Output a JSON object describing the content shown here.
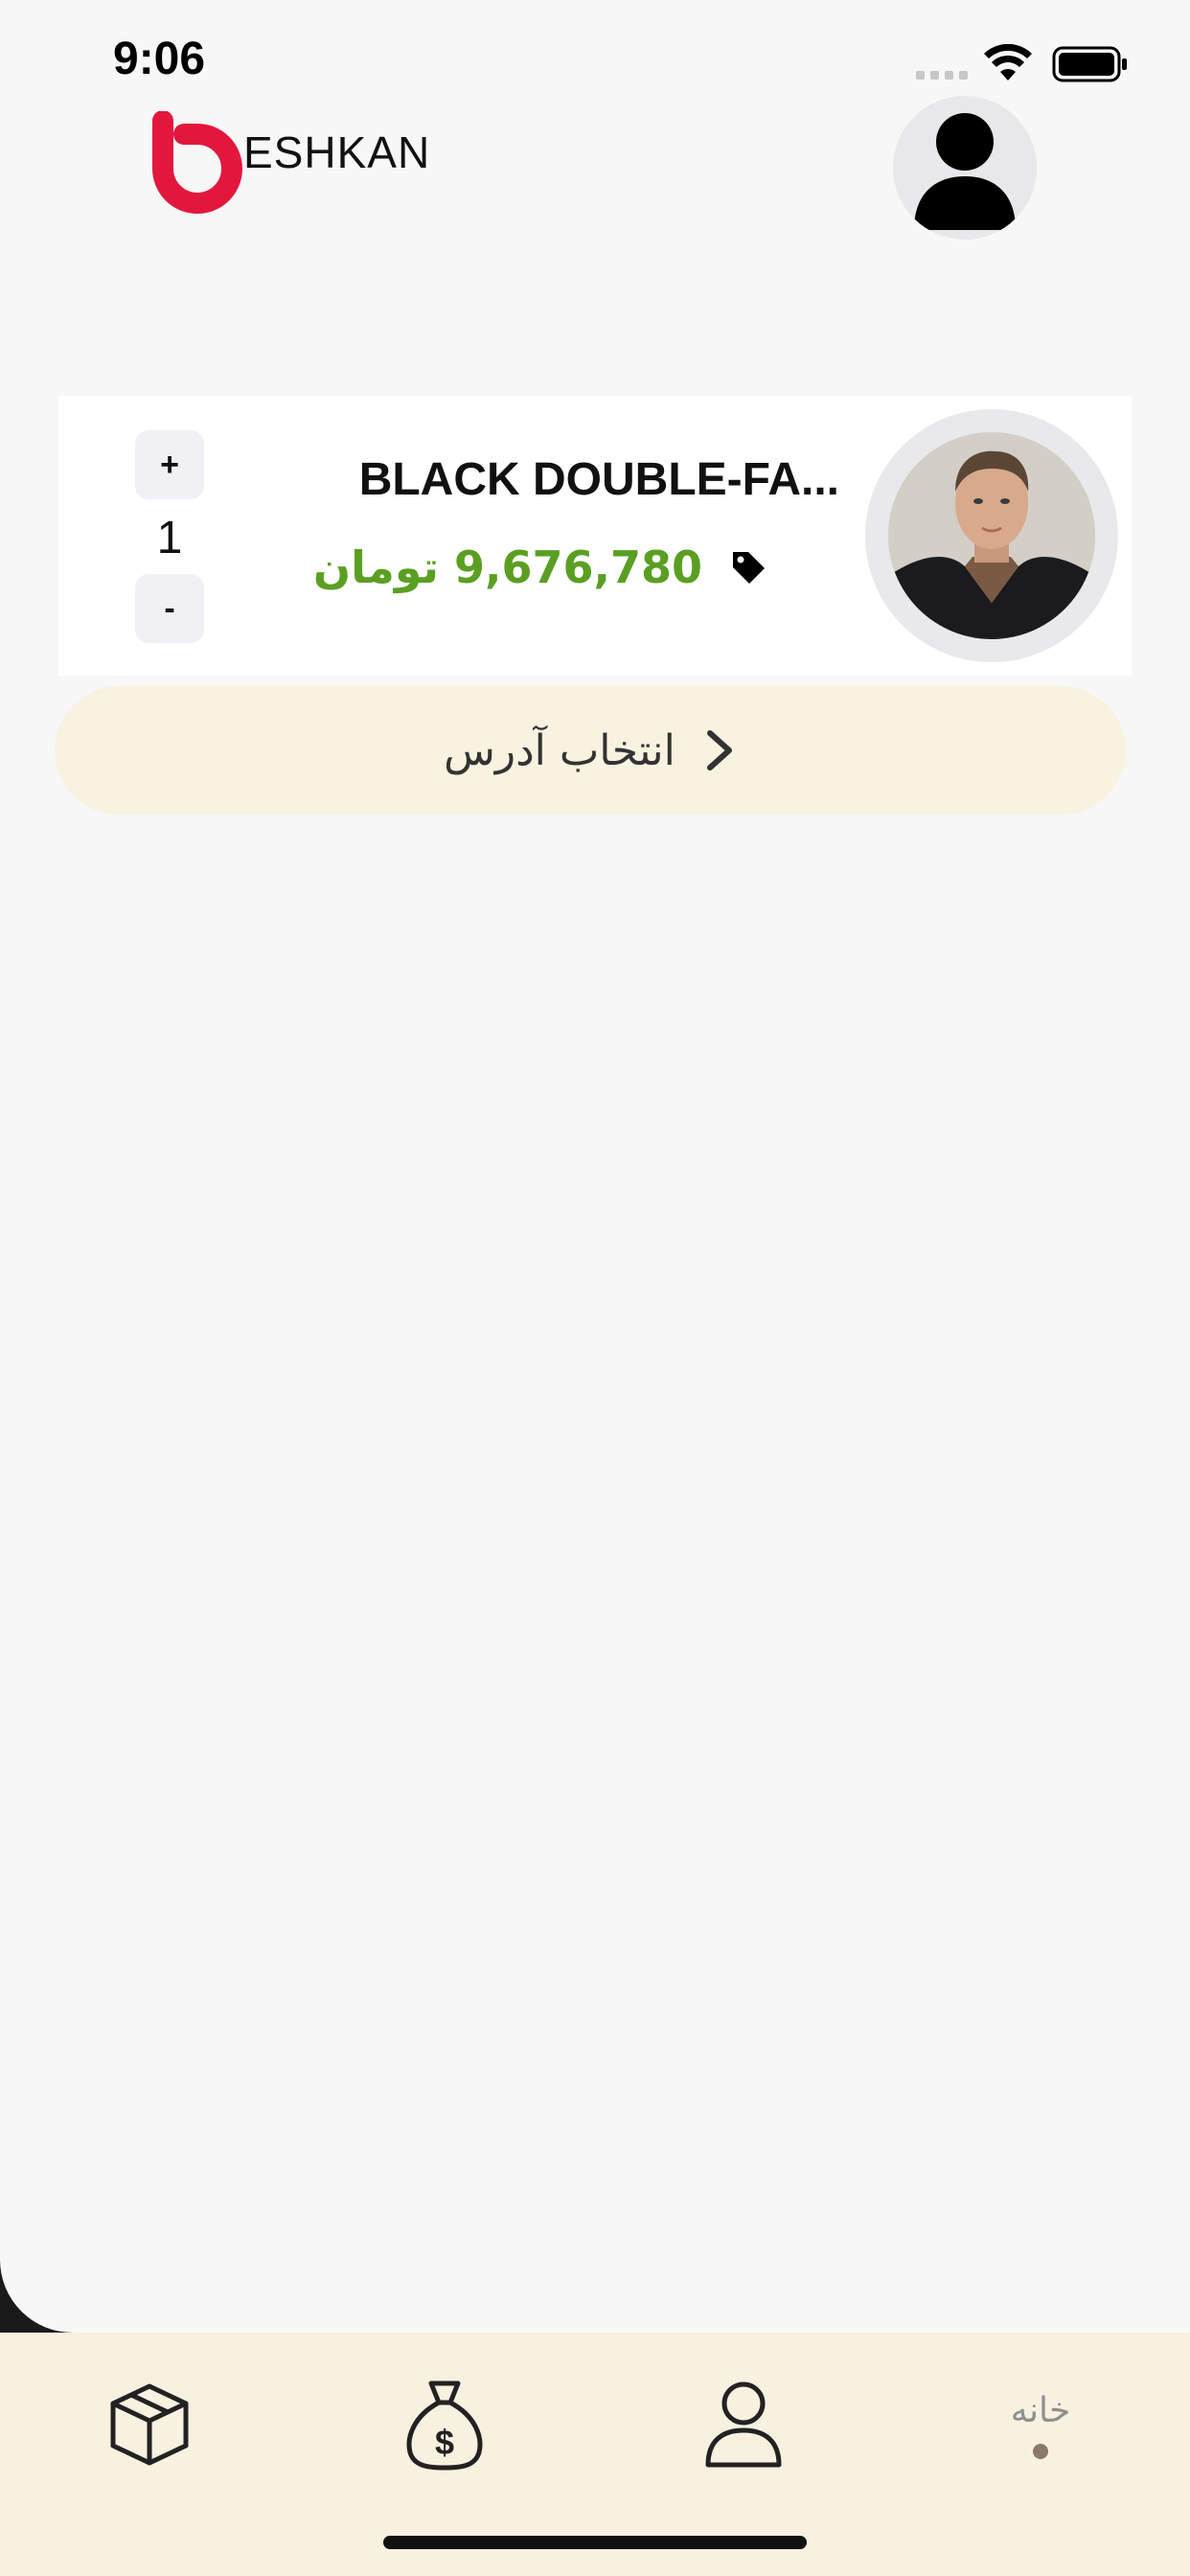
{
  "status_bar": {
    "time": "9:06"
  },
  "header": {
    "logo_text": "ESHKAN",
    "logo_color": "#e3173e",
    "avatar_icon": "user-avatar-icon"
  },
  "cart": {
    "items": [
      {
        "name": "BLACK DOUBLE-FA...",
        "price": "9,676,780 تومان",
        "price_color": "#5a9f22",
        "quantity": "1",
        "plus_label": "+",
        "minus_label": "-",
        "tag_icon": "price-tag-icon",
        "image": "product-photo"
      }
    ]
  },
  "address_button": {
    "label": "انتخاب آدرس",
    "icon": "chevron-right-icon",
    "background": "#f8f2e0"
  },
  "tabbar": {
    "background": "#f8f1e0",
    "tabs": [
      {
        "icon": "box-icon"
      },
      {
        "icon": "money-bag-icon"
      },
      {
        "icon": "user-icon"
      },
      {
        "label": "خانه",
        "active": true
      }
    ]
  }
}
